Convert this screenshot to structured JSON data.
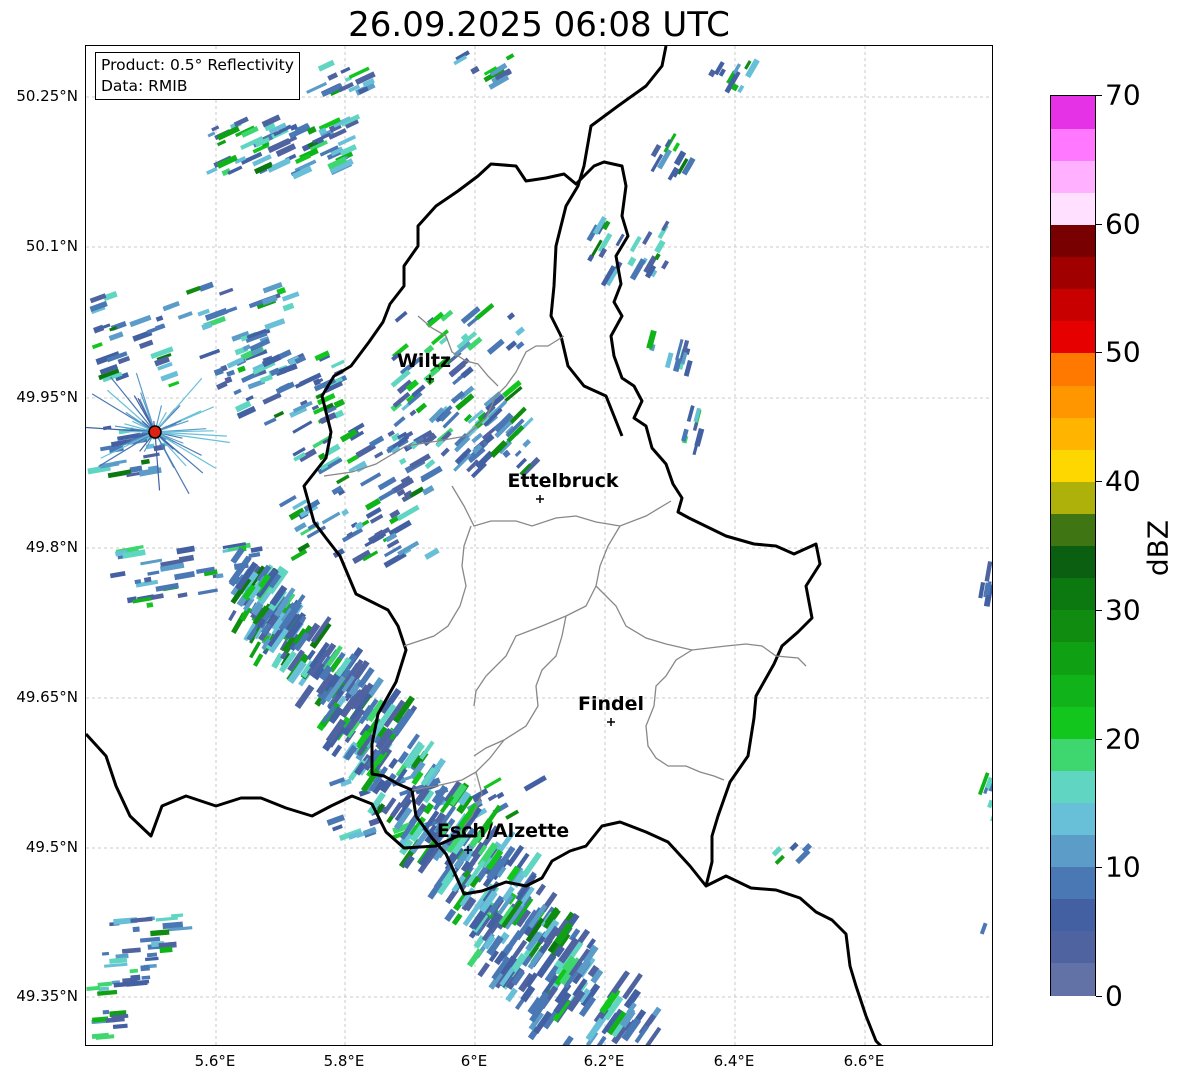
{
  "title": "26.09.2025 06:08 UTC",
  "info": {
    "product": "Product: 0.5° Reflectivity",
    "data_source": "Data: RMIB"
  },
  "lat_labels": [
    "50.25°N",
    "50.1°N",
    "49.95°N",
    "49.8°N",
    "49.65°N",
    "49.5°N",
    "49.35°N"
  ],
  "lon_labels": [
    "5.6°E",
    "5.8°E",
    "6°E",
    "6.2°E",
    "6.4°E",
    "6.6°E"
  ],
  "cities": [
    "Wiltz",
    "Ettelbruck",
    "Findel",
    "Esch/Alzette"
  ],
  "colorbar": {
    "unit": "dBZ",
    "tick_labels": [
      "0",
      "10",
      "20",
      "30",
      "40",
      "50",
      "60",
      "70"
    ],
    "colors": [
      "#6271a6",
      "#4f63a0",
      "#4360a3",
      "#4a78b4",
      "#5b9cc8",
      "#68c0d8",
      "#60d6c2",
      "#3ed66e",
      "#13c61e",
      "#10b41a",
      "#10a014",
      "#108c10",
      "#0c7810",
      "#0a6010",
      "#3f7512",
      "#adb10a",
      "#ffd700",
      "#ffb400",
      "#ff9600",
      "#ff7800",
      "#e60000",
      "#c80000",
      "#a00000",
      "#780000",
      "#ffe0ff",
      "#ffb0ff",
      "#ff78ff",
      "#e632e6"
    ]
  },
  "radar_site_color": "#e02010"
}
